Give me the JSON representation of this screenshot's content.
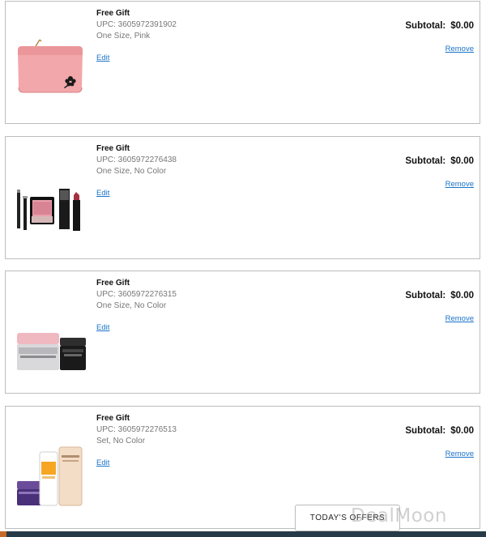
{
  "cart": {
    "items": [
      {
        "title": "Free Gift",
        "upc": "UPC: 3605972391902",
        "variant": "One Size, Pink",
        "edit_label": "Edit",
        "subtotal_label": "Subtotal:",
        "subtotal_value": "$0.00",
        "remove_label": "Remove"
      },
      {
        "title": "Free Gift",
        "upc": "UPC: 3605972276438",
        "variant": "One Size, No Color",
        "edit_label": "Edit",
        "subtotal_label": "Subtotal:",
        "subtotal_value": "$0.00",
        "remove_label": "Remove"
      },
      {
        "title": "Free Gift",
        "upc": "UPC: 3605972276315",
        "variant": "One Size, No Color",
        "edit_label": "Edit",
        "subtotal_label": "Subtotal:",
        "subtotal_value": "$0.00",
        "remove_label": "Remove"
      },
      {
        "title": "Free Gift",
        "upc": "UPC: 3605972276513",
        "variant": "Set, No Color",
        "edit_label": "Edit",
        "subtotal_label": "Subtotal:",
        "subtotal_value": "$0.00",
        "remove_label": "Remove"
      }
    ]
  },
  "offers_button": {
    "label": "TODAY'S OFFERS"
  },
  "watermark": {
    "text": "DealMoon"
  },
  "colors": {
    "link": "#1a73c8",
    "card_border": "#bdbdbd",
    "footer_bar": "#263b47",
    "footer_accent": "#c86a2a"
  }
}
